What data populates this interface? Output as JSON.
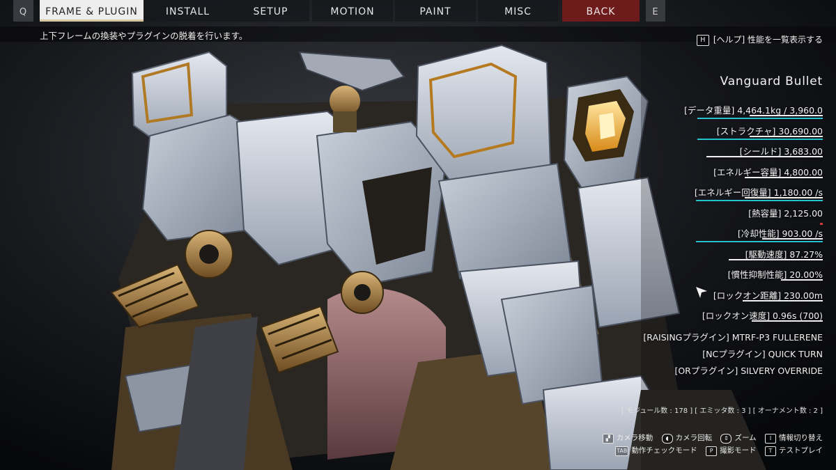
{
  "tabs": {
    "q_key": "Q",
    "frame_plugin": "FRAME & PLUGIN",
    "install": "INSTALL",
    "setup": "SETUP",
    "motion": "MOTION",
    "paint": "PAINT",
    "misc": "MISC",
    "back": "BACK",
    "e_key": "E"
  },
  "subtitle": {
    "description": "上下フレームの換装やプラグインの脱着を行います。",
    "help_key": "H",
    "help_label": "[ヘルプ] 性能を一覧表示する"
  },
  "mech": {
    "name": "Vanguard Bullet"
  },
  "stats": [
    {
      "label": "[データ重量] 4,464.1kg / 3,960.0",
      "white_bar": 0.42,
      "cyan_bar": 0.72,
      "red_marker": false
    },
    {
      "label": "[ストラクチャ] 30,690.00",
      "white_bar": 0.42,
      "cyan_bar": 0.72,
      "red_marker": false
    },
    {
      "label": "[シールド] 3,683.00",
      "white_bar": 0.67,
      "cyan_bar": 0,
      "red_marker": false
    },
    {
      "label": "[エネルギー容量] 4,800.00",
      "white_bar": 0.45,
      "cyan_bar": 0,
      "red_marker": false
    },
    {
      "label": "[エネルギー回復量] 1,180.00 /s",
      "white_bar": 0.45,
      "cyan_bar": 0.73,
      "red_marker": false
    },
    {
      "label": "[熱容量] 2,125.00",
      "white_bar": 0,
      "cyan_bar": 0,
      "red_marker": true
    },
    {
      "label": "[冷却性能] 903.00 /s",
      "white_bar": 0.35,
      "cyan_bar": 0.73,
      "red_marker": false
    },
    {
      "label": "[駆動速度] 87.27%",
      "white_bar": 0.54,
      "cyan_bar": 0,
      "red_marker": false
    },
    {
      "label": "[慣性抑制性能] 20.00%",
      "white_bar": 0.24,
      "cyan_bar": 0,
      "red_marker": false
    },
    {
      "label": "[ロックオン距離] 230.00m",
      "white_bar": 0.46,
      "cyan_bar": 0,
      "red_marker": false
    },
    {
      "label": "[ロックオン速度] 0.96s (700)",
      "white_bar": 0.41,
      "cyan_bar": 0,
      "red_marker": false
    }
  ],
  "plugins": [
    "[RAISINGプラグイン] MTRF-P3 FULLERENE",
    "[NCプラグイン] QUICK TURN",
    "[ORプラグイン] SILVERY OVERRIDE"
  ],
  "counts": "[ モジュール数 : 178 ] [ エミッタ数 : 3 ] [ オーナメント数 : 2 ]",
  "controls": {
    "row1": [
      {
        "icon": "move-icon",
        "key": "▞",
        "label": "カメラ移動"
      },
      {
        "icon": "mouse-icon",
        "key": "◖",
        "label": "カメラ回転"
      },
      {
        "icon": "scroll-icon",
        "key": "⇕",
        "label": "ズーム"
      },
      {
        "icon": "info-key-icon",
        "key": "I",
        "label": "情報切り替え"
      }
    ],
    "row2": [
      {
        "icon": "tab-key-icon",
        "key": "TAB",
        "label": "動作チェックモード"
      },
      {
        "icon": "photo-key-icon",
        "key": "P",
        "label": "撮影モード"
      },
      {
        "icon": "test-key-icon",
        "key": "T",
        "label": "テストプレイ"
      }
    ]
  },
  "colors": {
    "active_tab_bg": "#eeeeee",
    "back_tab_bg": "#6e1b1b",
    "cyan_bar": "#27c0d0",
    "red_marker": "#d23a3a"
  }
}
